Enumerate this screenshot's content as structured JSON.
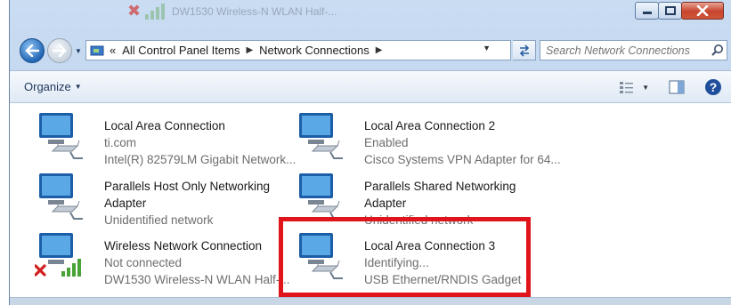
{
  "window": {
    "ghost_title": "DW1530 Wireless-N WLAN Half-...",
    "controls": [
      "minimize",
      "maximize",
      "close"
    ]
  },
  "address_bar": {
    "prefix": "«",
    "crumbs": [
      "All Control Panel Items",
      "Network Connections"
    ],
    "search_placeholder": "Search Network Connections"
  },
  "toolbar": {
    "organize_label": "Organize"
  },
  "connections": [
    {
      "name": "Local Area Connection",
      "status": "ti.com",
      "device": "Intel(R) 82579LM Gigabit Network...",
      "state": "normal"
    },
    {
      "name": "Local Area Connection 2",
      "status": "Enabled",
      "device": "Cisco Systems VPN Adapter for 64...",
      "state": "normal"
    },
    {
      "name": "Parallels Host Only Networking",
      "name2": "Adapter",
      "status": "Unidentified network",
      "state": "normal"
    },
    {
      "name": "Parallels Shared Networking",
      "name2": "Adapter",
      "status": "Unidentified network",
      "state": "normal"
    },
    {
      "name": "Wireless Network Connection",
      "status": "Not connected",
      "device": "DW1530 Wireless-N WLAN Half-...",
      "state": "disconnected"
    },
    {
      "name": "Local Area Connection 3",
      "status": "Identifying...",
      "device": "USB Ethernet/RNDIS Gadget",
      "state": "normal"
    }
  ],
  "colors": {
    "highlight": "#e0141b",
    "frame": "#c9dcf2",
    "text_secondary": "#6d6d6d"
  }
}
